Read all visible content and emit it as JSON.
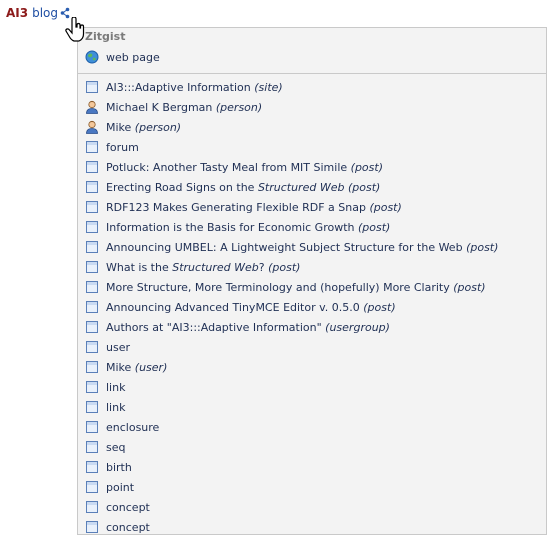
{
  "header": {
    "brand": "AI3",
    "blog": "blog"
  },
  "panel": {
    "title": "Zitgist",
    "web_page": {
      "label": "web page",
      "icon": "globe-icon"
    },
    "items": [
      {
        "pre": "AI3:::Adaptive Information",
        "em": "",
        "post": "",
        "type": "(site)",
        "icon": "document-icon"
      },
      {
        "pre": "Michael K Bergman",
        "em": "",
        "post": "",
        "type": "(person)",
        "icon": "person-icon"
      },
      {
        "pre": "Mike",
        "em": "",
        "post": "",
        "type": "(person)",
        "icon": "person-icon"
      },
      {
        "pre": "forum",
        "em": "",
        "post": "",
        "type": "",
        "icon": "document-icon"
      },
      {
        "pre": "Potluck: Another Tasty Meal from MIT Simile",
        "em": "",
        "post": "",
        "type": "(post)",
        "icon": "document-icon"
      },
      {
        "pre": "Erecting Road Signs on the ",
        "em": "Structured Web",
        "post": "",
        "type": "(post)",
        "icon": "document-icon"
      },
      {
        "pre": "RDF123 Makes Generating Flexible RDF a Snap",
        "em": "",
        "post": "",
        "type": "(post)",
        "icon": "document-icon"
      },
      {
        "pre": "Information is the Basis for Economic Growth",
        "em": "",
        "post": "",
        "type": "(post)",
        "icon": "document-icon"
      },
      {
        "pre": "Announcing UMBEL: A Lightweight Subject Structure for the Web",
        "em": "",
        "post": "",
        "type": "(post)",
        "icon": "document-icon"
      },
      {
        "pre": "What is the ",
        "em": "Structured Web",
        "post": "?",
        "type": "(post)",
        "icon": "document-icon"
      },
      {
        "pre": "More Structure, More Terminology and (hopefully) More Clarity",
        "em": "",
        "post": "",
        "type": "(post)",
        "icon": "document-icon"
      },
      {
        "pre": "Announcing Advanced TinyMCE Editor v. 0.5.0",
        "em": "",
        "post": "",
        "type": "(post)",
        "icon": "document-icon"
      },
      {
        "pre": "Authors at \"AI3:::Adaptive Information\"",
        "em": "",
        "post": "",
        "type": "(usergroup)",
        "icon": "document-icon"
      },
      {
        "pre": "user",
        "em": "",
        "post": "",
        "type": "",
        "icon": "document-icon"
      },
      {
        "pre": "Mike",
        "em": "",
        "post": "",
        "type": "(user)",
        "icon": "document-icon"
      },
      {
        "pre": "link",
        "em": "",
        "post": "",
        "type": "",
        "icon": "document-icon"
      },
      {
        "pre": "link",
        "em": "",
        "post": "",
        "type": "",
        "icon": "document-icon"
      },
      {
        "pre": "enclosure",
        "em": "",
        "post": "",
        "type": "",
        "icon": "document-icon"
      },
      {
        "pre": "seq",
        "em": "",
        "post": "",
        "type": "",
        "icon": "document-icon"
      },
      {
        "pre": "birth",
        "em": "",
        "post": "",
        "type": "",
        "icon": "document-icon"
      },
      {
        "pre": "point",
        "em": "",
        "post": "",
        "type": "",
        "icon": "document-icon"
      },
      {
        "pre": "concept",
        "em": "",
        "post": "",
        "type": "",
        "icon": "document-icon"
      },
      {
        "pre": "concept",
        "em": "",
        "post": "",
        "type": "",
        "icon": "document-icon"
      }
    ]
  }
}
